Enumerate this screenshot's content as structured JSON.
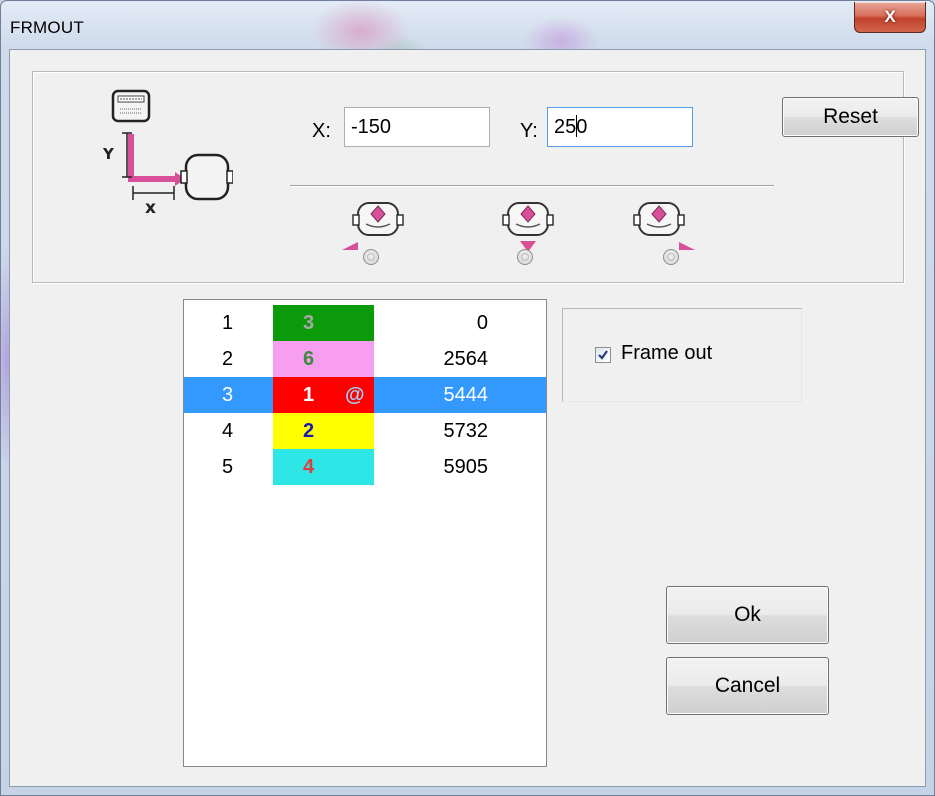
{
  "window": {
    "title": "FRMOUT",
    "close_label": "X"
  },
  "offset": {
    "x_label": "X:",
    "x_value": "-150",
    "y_label": "Y:",
    "y_value_before_caret": "25",
    "y_value_after_caret": "0",
    "reset_label": "Reset"
  },
  "position_options": [
    {
      "name": "left",
      "selected": false
    },
    {
      "name": "bottom",
      "selected": false
    },
    {
      "name": "right",
      "selected": false
    }
  ],
  "color_list": {
    "rows": [
      {
        "index": "1",
        "needle": "3",
        "needle_color": "#a8a8a8",
        "swatch": "#0a9a0a",
        "marker": "",
        "stitches": "0",
        "selected": false
      },
      {
        "index": "2",
        "needle": "6",
        "needle_color": "#3c8a3c",
        "swatch": "#f79ef0",
        "marker": "",
        "stitches": "2564",
        "selected": false
      },
      {
        "index": "3",
        "needle": "1",
        "needle_color": "#ffffff",
        "swatch": "#ff0000",
        "marker": "@",
        "stitches": "5444",
        "selected": true
      },
      {
        "index": "4",
        "needle": "2",
        "needle_color": "#1a1ab4",
        "swatch": "#ffff00",
        "marker": "",
        "stitches": "5732",
        "selected": false
      },
      {
        "index": "5",
        "needle": "4",
        "needle_color": "#e03c3c",
        "swatch": "#2ee6e6",
        "marker": "",
        "stitches": "5905",
        "selected": false
      }
    ]
  },
  "frame_out": {
    "label": "Frame out",
    "checked": true
  },
  "buttons": {
    "ok": "Ok",
    "cancel": "Cancel"
  },
  "colors": {
    "selection": "#3399ff",
    "icon_pink": "#d8509a"
  }
}
